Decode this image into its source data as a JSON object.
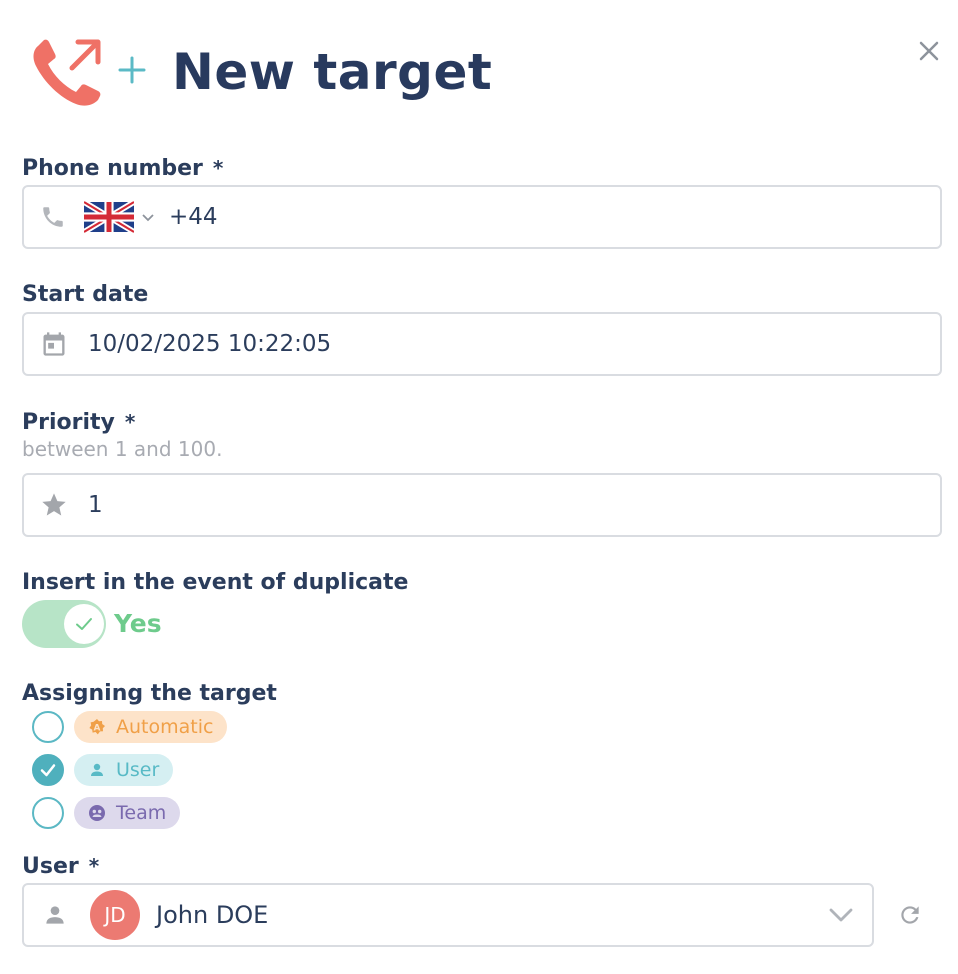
{
  "header": {
    "title": "New target",
    "icon": "outgoing-call-icon",
    "accent_color": "#ef7166",
    "plus_color": "#5bbac6"
  },
  "phone": {
    "label": "Phone number",
    "required_mark": "*",
    "country_flag": "uk-flag-icon",
    "value": "+44"
  },
  "start_date": {
    "label": "Start date",
    "value": "10/02/2025 10:22:05"
  },
  "priority": {
    "label": "Priority",
    "required_mark": "*",
    "hint": "between 1 and 100.",
    "value": "1"
  },
  "duplicate": {
    "label": "Insert in the event of duplicate",
    "toggle_on": true,
    "toggle_text": "Yes",
    "toggle_color": "#b7e4c7"
  },
  "assign": {
    "label": "Assigning the target",
    "options": [
      {
        "label": "Automatic",
        "checked": false
      },
      {
        "label": "User",
        "checked": true
      },
      {
        "label": "Team",
        "checked": false
      }
    ]
  },
  "user": {
    "label": "User",
    "required_mark": "*",
    "avatar_initials": "JD",
    "value": "John DOE"
  }
}
